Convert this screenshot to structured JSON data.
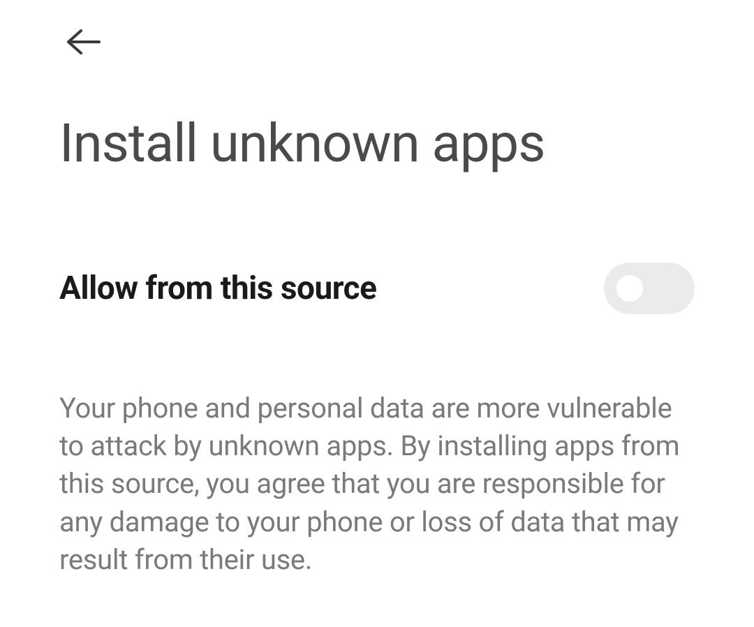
{
  "header": {
    "title": "Install unknown apps"
  },
  "setting": {
    "label": "Allow from this source",
    "enabled": false
  },
  "description": {
    "text": "Your phone and personal data are more vulnerable to attack by unknown apps. By installing apps from this source, you agree that you are responsible for any damage to your phone or loss of data that may result from their use."
  }
}
